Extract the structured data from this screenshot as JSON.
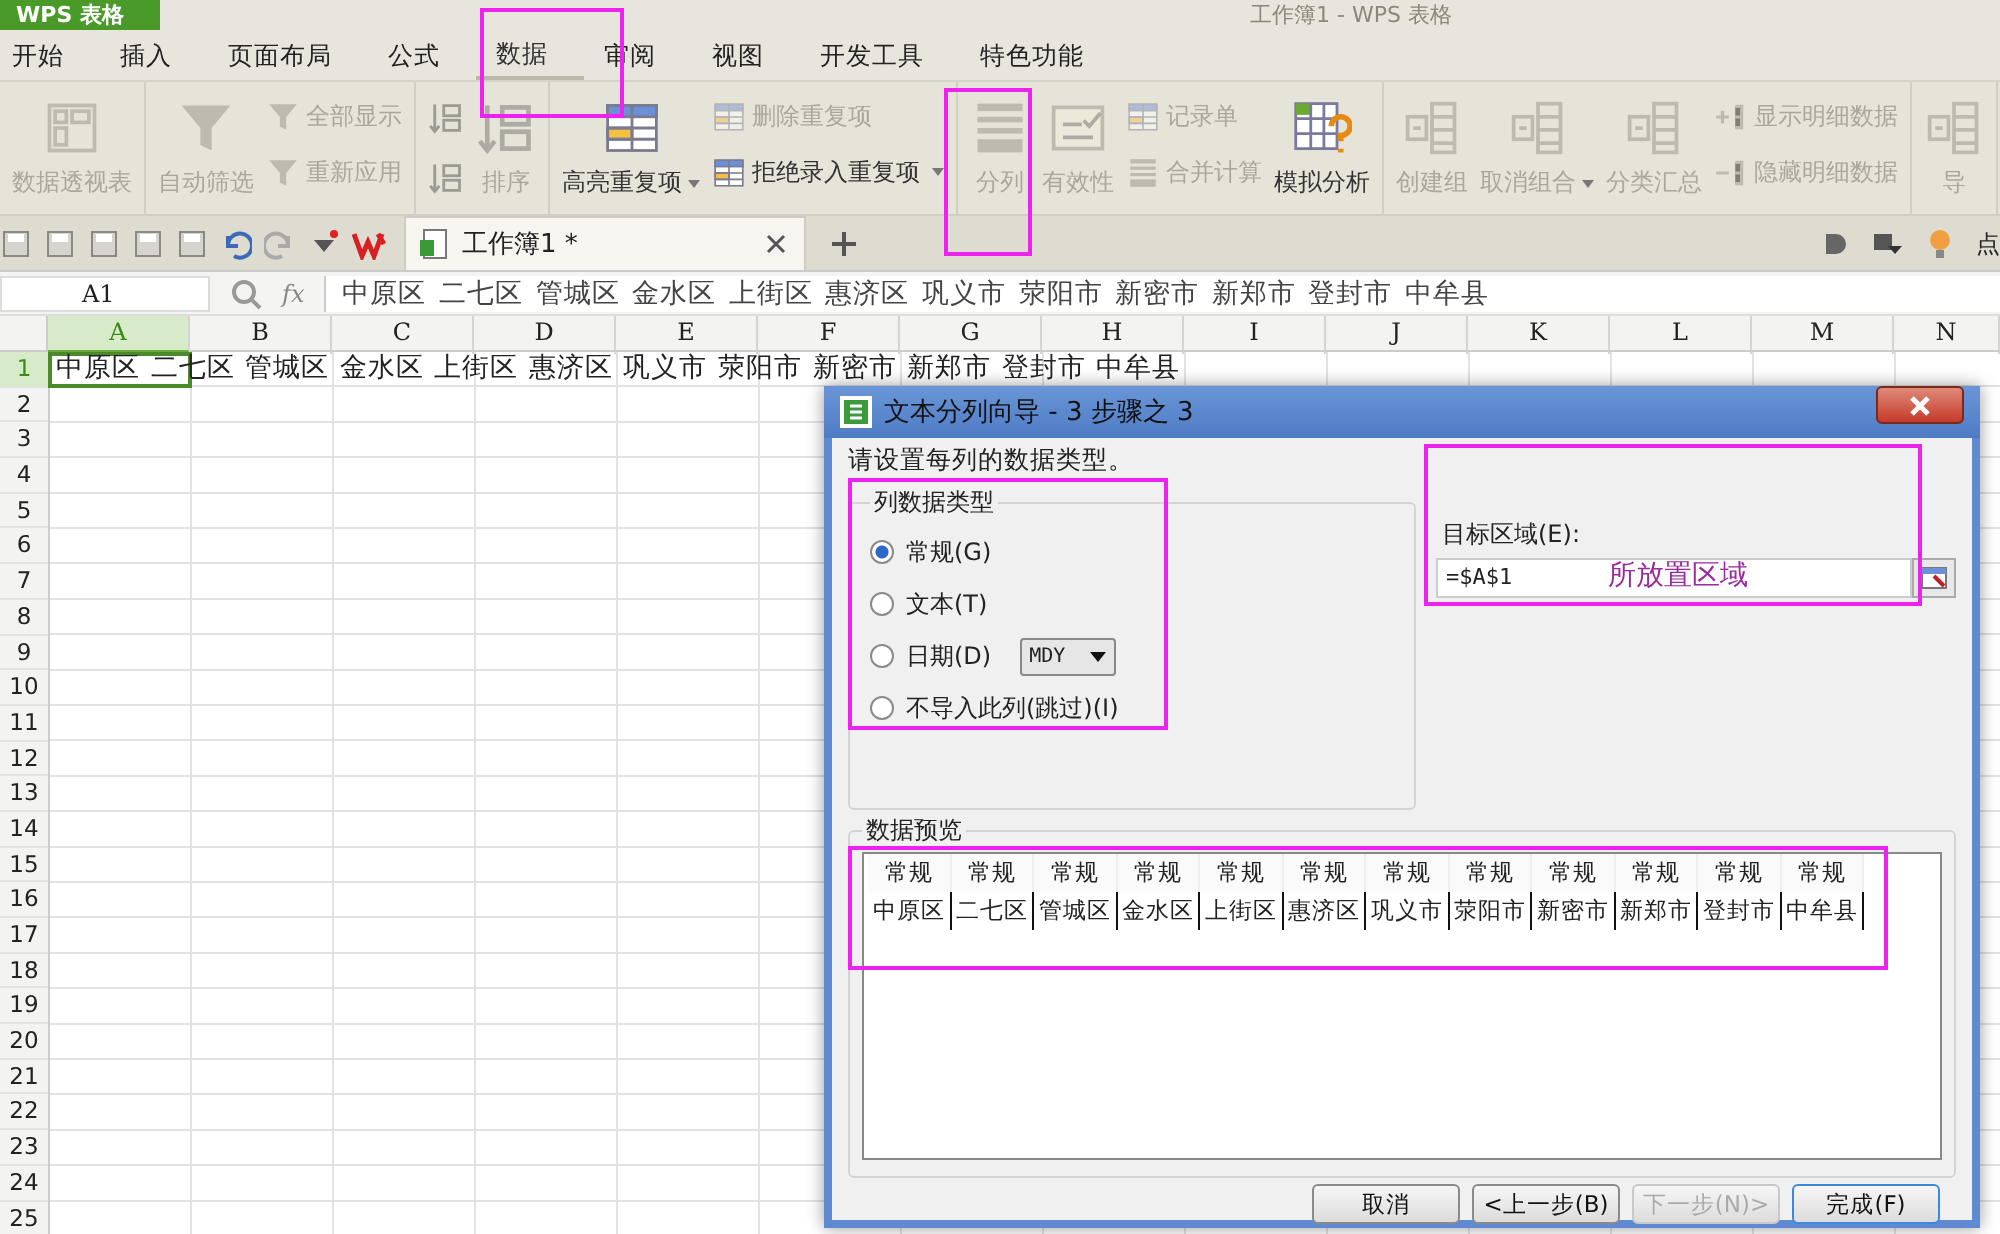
{
  "app_button": "WPS 表格",
  "window_title": "工作簿1 - WPS 表格",
  "menu_tabs": [
    {
      "label": "开始",
      "selected": false
    },
    {
      "label": "插入",
      "selected": false
    },
    {
      "label": "页面布局",
      "selected": false
    },
    {
      "label": "公式",
      "selected": false
    },
    {
      "label": "数据",
      "selected": true
    },
    {
      "label": "审阅",
      "selected": false
    },
    {
      "label": "视图",
      "selected": false
    },
    {
      "label": "开发工具",
      "selected": false
    },
    {
      "label": "特色功能",
      "selected": false
    }
  ],
  "ribbon": {
    "groups": [
      {
        "columns": [
          [
            {
              "kind": "large",
              "label": "数据透视表",
              "disabled": true
            }
          ]
        ]
      },
      {
        "columns": [
          [
            {
              "kind": "large",
              "label": "自动筛选",
              "disabled": true
            }
          ],
          [
            {
              "kind": "small",
              "label": "全部显示",
              "disabled": true
            },
            {
              "kind": "small",
              "label": "重新应用",
              "disabled": true
            }
          ]
        ]
      },
      {
        "columns": [
          [
            {
              "kind": "icon",
              "disabled": true
            },
            {
              "kind": "icon",
              "disabled": true
            }
          ],
          [
            {
              "kind": "large",
              "label": "排序",
              "disabled": true
            }
          ]
        ]
      },
      {
        "columns": [
          [
            {
              "kind": "large",
              "label": "高亮重复项",
              "disabled": false,
              "dropdown": true
            }
          ],
          [
            {
              "kind": "small",
              "label": "删除重复项",
              "disabled": true
            },
            {
              "kind": "small",
              "label": "拒绝录入重复项",
              "disabled": false,
              "dropdown": true
            }
          ]
        ]
      },
      {
        "columns": [
          [
            {
              "kind": "large",
              "label": "分列",
              "disabled": true
            }
          ],
          [
            {
              "kind": "large",
              "label": "有效性",
              "disabled": true
            }
          ],
          [
            {
              "kind": "small",
              "label": "记录单",
              "disabled": true
            },
            {
              "kind": "small",
              "label": "合并计算",
              "disabled": true
            }
          ],
          [
            {
              "kind": "large",
              "label": "模拟分析",
              "disabled": false
            }
          ]
        ]
      },
      {
        "columns": [
          [
            {
              "kind": "large",
              "label": "创建组",
              "disabled": true
            }
          ],
          [
            {
              "kind": "large",
              "label": "取消组合",
              "disabled": true,
              "dropdown": true
            }
          ],
          [
            {
              "kind": "large",
              "label": "分类汇总",
              "disabled": true
            }
          ],
          [
            {
              "kind": "small",
              "label": "显示明细数据",
              "disabled": true
            },
            {
              "kind": "small",
              "label": "隐藏明细数据",
              "disabled": true
            }
          ]
        ]
      },
      {
        "columns": [
          [
            {
              "kind": "large",
              "label": "导",
              "disabled": true
            }
          ]
        ]
      }
    ]
  },
  "document_tabs": [
    {
      "label": "工作簿1 *",
      "selected": true
    }
  ],
  "toolbar_right_text": "点",
  "formula_bar": {
    "name_box": "A1",
    "fx": "fx",
    "formula": "中原区 二七区 管城区 金水区 上街区 惠济区 巩义市 荥阳市 新密市 新郑市 登封市 中牟县"
  },
  "sheet": {
    "columns": [
      {
        "label": "A",
        "selected": true
      },
      {
        "label": "B",
        "selected": false
      },
      {
        "label": "C",
        "selected": false
      },
      {
        "label": "D",
        "selected": false
      },
      {
        "label": "E",
        "selected": false
      },
      {
        "label": "F",
        "selected": false
      },
      {
        "label": "G",
        "selected": false
      },
      {
        "label": "H",
        "selected": false
      },
      {
        "label": "I",
        "selected": false
      },
      {
        "label": "J",
        "selected": false
      },
      {
        "label": "K",
        "selected": false
      },
      {
        "label": "L",
        "selected": false
      },
      {
        "label": "M",
        "selected": false
      },
      {
        "label": "N",
        "selected": false
      }
    ],
    "rows": [
      {
        "label": "1",
        "selected": true,
        "text": "中原区 二七区 管城区 金水区 上街区 惠济区 巩义市 荥阳市 新密市 新郑市 登封市 中牟县"
      },
      {
        "label": "2",
        "selected": false
      },
      {
        "label": "3",
        "selected": false
      },
      {
        "label": "4",
        "selected": false
      },
      {
        "label": "5",
        "selected": false
      },
      {
        "label": "6",
        "selected": false
      },
      {
        "label": "7",
        "selected": false
      },
      {
        "label": "8",
        "selected": false
      },
      {
        "label": "9",
        "selected": false
      },
      {
        "label": "10",
        "selected": false
      },
      {
        "label": "11",
        "selected": false
      },
      {
        "label": "12",
        "selected": false
      },
      {
        "label": "13",
        "selected": false
      },
      {
        "label": "14",
        "selected": false
      },
      {
        "label": "15",
        "selected": false
      },
      {
        "label": "16",
        "selected": false
      },
      {
        "label": "17",
        "selected": false
      },
      {
        "label": "18",
        "selected": false
      },
      {
        "label": "19",
        "selected": false
      },
      {
        "label": "20",
        "selected": false
      },
      {
        "label": "21",
        "selected": false
      },
      {
        "label": "22",
        "selected": false
      },
      {
        "label": "23",
        "selected": false
      },
      {
        "label": "24",
        "selected": false
      },
      {
        "label": "25",
        "selected": false
      }
    ]
  },
  "dialog": {
    "title": "文本分列向导 - 3 步骤之 3",
    "instruction": "请设置每列的数据类型。",
    "column_type": {
      "legend": "列数据类型",
      "options": [
        {
          "label": "常规(G)",
          "selected": true
        },
        {
          "label": "文本(T)",
          "selected": false
        },
        {
          "label": "日期(D)",
          "selected": false,
          "format": "MDY"
        },
        {
          "label": "不导入此列(跳过)(I)",
          "selected": false
        }
      ]
    },
    "destination": {
      "label": "目标区域(E):",
      "value": "=$A$1"
    },
    "preview": {
      "legend": "数据预览",
      "header": [
        "常规",
        "常规",
        "常规",
        "常规",
        "常规",
        "常规",
        "常规",
        "常规",
        "常规",
        "常规",
        "常规",
        "常规"
      ],
      "row": [
        "中原区",
        "二七区",
        "管城区",
        "金水区",
        "上街区",
        "惠济区",
        "巩义市",
        "荥阳市",
        "新密市",
        "新郑市",
        "登封市",
        "中牟县"
      ]
    },
    "buttons": [
      {
        "label": "取消",
        "default": false,
        "disabled": false
      },
      {
        "label": "<上一步(B)",
        "default": false,
        "disabled": false
      },
      {
        "label": "下一步(N)>",
        "default": false,
        "disabled": true
      },
      {
        "label": "完成(F)",
        "default": true,
        "disabled": false
      }
    ]
  },
  "annotation": {
    "text": "所放置区域"
  }
}
